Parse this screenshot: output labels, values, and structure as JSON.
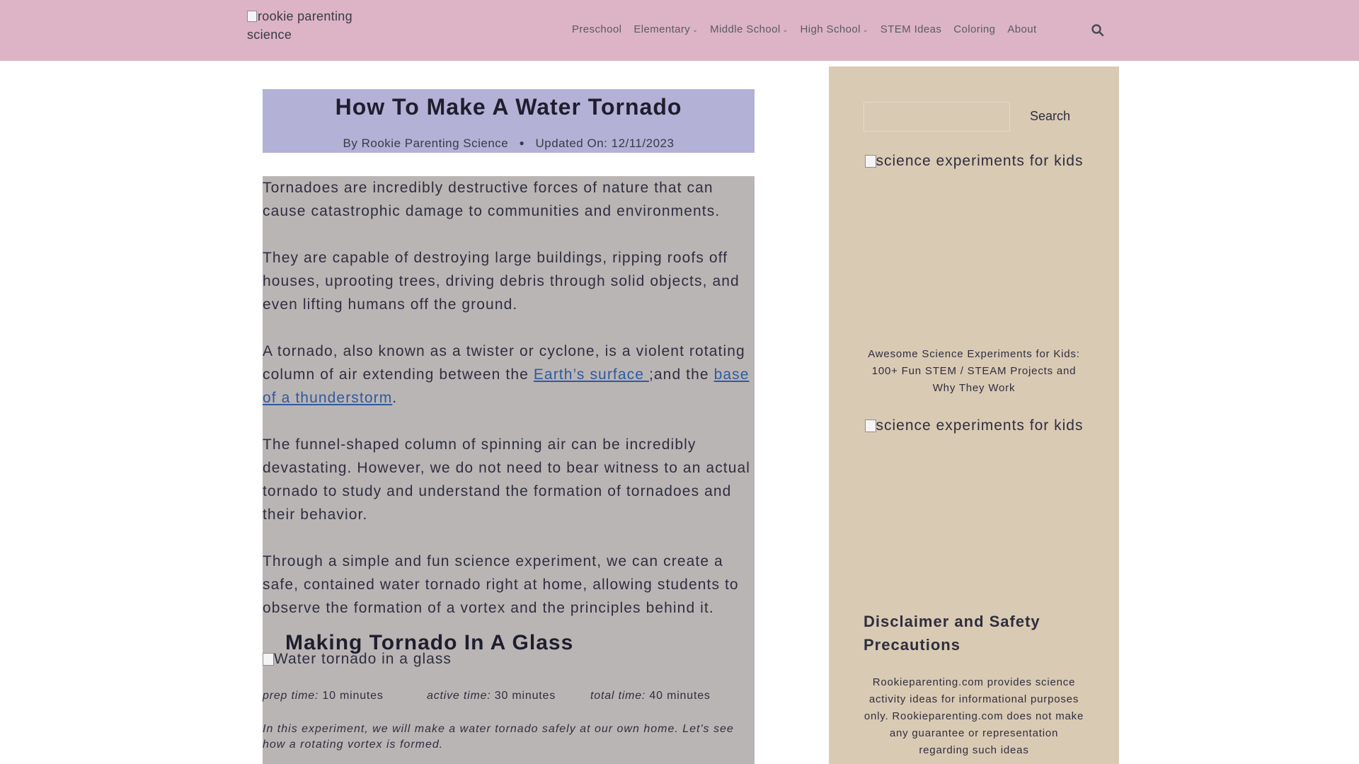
{
  "header": {
    "logo_alt": "rookie parenting science",
    "nav": [
      {
        "label": "Preschool"
      },
      {
        "label": "Elementary"
      },
      {
        "label": "Middle School"
      },
      {
        "label": "High School"
      },
      {
        "label": "STEM Ideas"
      },
      {
        "label": "Coloring"
      },
      {
        "label": "About"
      }
    ]
  },
  "article": {
    "title": "How To Make A Water Tornado",
    "by": "By",
    "author": "Rookie Parenting Science",
    "updated_label": "Updated On:",
    "updated_date": "12/11/2023",
    "p1": "Tornadoes are incredibly destructive forces of nature that can cause catastrophic damage to communities and environments.",
    "p2": "They are capable of destroying large buildings, ripping roofs off houses, uprooting trees, driving debris through solid objects, and even lifting humans off the ground.",
    "p3_a": "A tornado, also known as a twister or cyclone, is a violent rotating column of air extending between the ",
    "p3_link1": "Earth’s surface ",
    "p3_b": ";and the ",
    "p3_link2": "base of a thunderstorm",
    "p3_c": ".",
    "p4": "The funnel-shaped column of spinning air can be incredibly devastating. However, we do not need to bear witness to an actual tornado to study and understand the formation of tornadoes and their behavior.",
    "p5": "Through a simple and fun science experiment, we can create a safe, contained water tornado right at home, allowing students to observe the formation of a vortex and the principles behind it.",
    "subheading": "Making Tornado In A Glass",
    "image_alt": "Water tornado in a glass",
    "prep_label": "prep time:",
    "prep_value": "10 minutes",
    "active_label": "active time:",
    "active_value": "30 minutes",
    "total_label": "total time:",
    "total_value": "40 minutes",
    "intro": "In this experiment, we will make a water tornado safely at our own home. Let's see how a rotating vortex is formed."
  },
  "sidebar": {
    "search_label": "Search",
    "image1_alt": "science experiments for kids",
    "caption1": "Awesome Science Experiments for Kids: 100+ Fun STEM / STEAM Projects and Why They Work",
    "image2_alt": "science experiments for kids",
    "disclaimer_heading": "Disclaimer and Safety Precautions",
    "disclaimer_text": "Rookieparenting.com provides science activity ideas for informational purposes only. Rookieparenting.com does not make any guarantee or representation regarding such ideas"
  },
  "colors": {
    "header_bg": "#dcb4c5",
    "title_box_bg": "#b3b1d6",
    "content_bg": "#bab5b5",
    "sidebar_bg": "#d9cab4",
    "link": "#2e5a9e"
  }
}
